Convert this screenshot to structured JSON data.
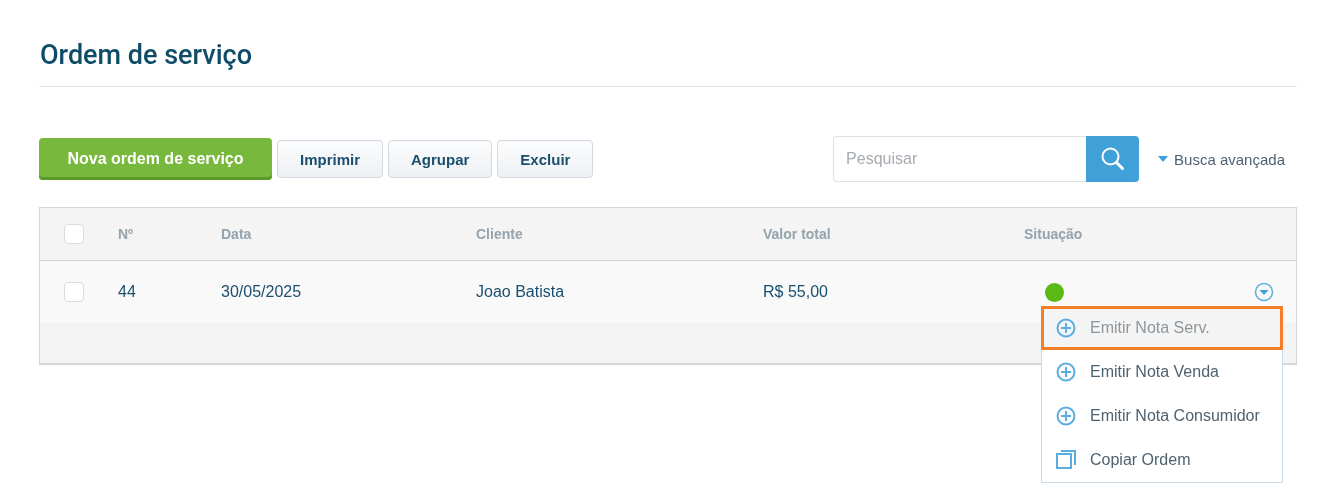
{
  "page": {
    "title": "Ordem de serviço"
  },
  "toolbar": {
    "primary_button": "Nova ordem de serviço",
    "buttons": [
      "Imprimir",
      "Agrupar",
      "Excluir"
    ]
  },
  "search": {
    "placeholder": "Pesquisar",
    "advanced_link": "Busca avançada"
  },
  "table": {
    "header_checked": false,
    "columns": [
      "Nº",
      "Data",
      "Cliente",
      "Valor total",
      "Situação"
    ],
    "rows": [
      {
        "checked": false,
        "number": "44",
        "date": "30/05/2025",
        "client": "Joao Batista",
        "total": "R$ 55,00",
        "color": "#5ab914"
      }
    ]
  },
  "row_menu": [
    {
      "kind": "add",
      "label": "Emitir Nota Serv.",
      "selected": true
    },
    {
      "kind": "add",
      "label": "Emitir Nota Venda",
      "selected": false
    },
    {
      "kind": "add",
      "label": "Emitir Nota Consumidor",
      "selected": false
    },
    {
      "kind": "copy",
      "label": "Copiar Ordem",
      "selected": false
    }
  ]
}
